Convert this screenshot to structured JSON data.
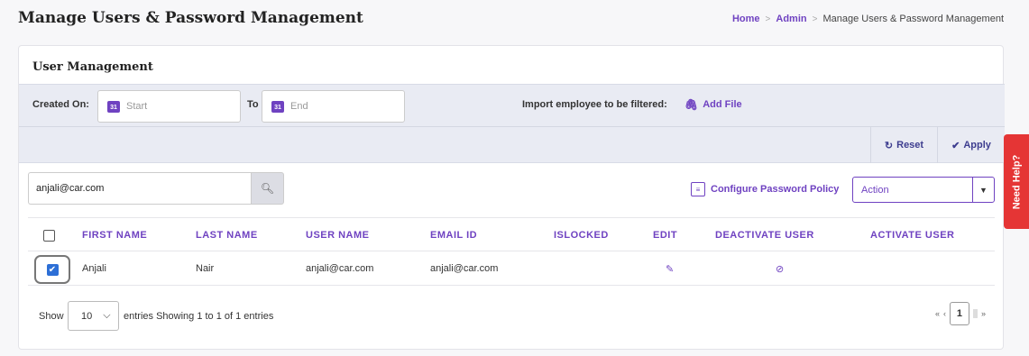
{
  "page": {
    "title": "Manage Users & Password Management"
  },
  "breadcrumb": {
    "home": "Home",
    "admin": "Admin",
    "current": "Manage Users & Password Management",
    "separator": ">"
  },
  "card": {
    "title": "User Management"
  },
  "filter": {
    "created_on_label": "Created On:",
    "start_placeholder": "Start",
    "to_label": "To",
    "end_placeholder": "End",
    "calendar_day": "31",
    "import_label": "Import employee to be filtered:",
    "add_file_label": "Add File",
    "reset_label": "Reset",
    "apply_label": "Apply"
  },
  "search": {
    "value": "anjali@car.com"
  },
  "toolbar": {
    "configure_label": "Configure Password Policy",
    "action_value": "Action"
  },
  "table": {
    "headers": [
      "FIRST NAME",
      "LAST NAME",
      "USER NAME",
      "EMAIL ID",
      "ISLOCKED",
      "EDIT",
      "DEACTIVATE USER",
      "ACTIVATE USER"
    ],
    "rows": [
      {
        "checked": true,
        "first_name": "Anjali",
        "last_name": "Nair",
        "user_name": "anjali@car.com",
        "email": "anjali@car.com",
        "islocked": ""
      }
    ]
  },
  "footer": {
    "show_label": "Show",
    "page_length": "10",
    "info": "entries Showing 1 to 1 of 1 entries",
    "current_page": "1"
  },
  "help": {
    "label": "Need Help?"
  },
  "colors": {
    "accent": "#6f42c1",
    "help_bg": "#e53535",
    "filter_bg": "#e9ebf3"
  }
}
